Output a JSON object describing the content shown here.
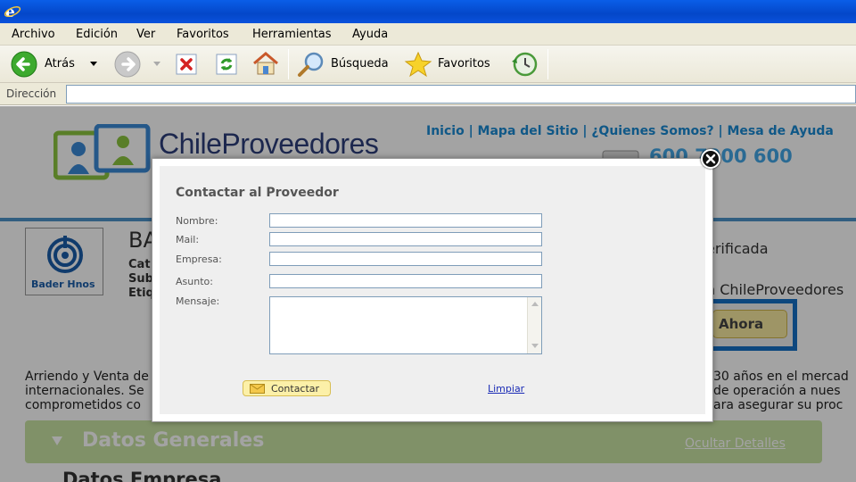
{
  "menu": {
    "items": [
      {
        "label": "Archivo"
      },
      {
        "label": "Edición"
      },
      {
        "label": "Ver"
      },
      {
        "label": "Favoritos"
      },
      {
        "label": "Herramientas"
      },
      {
        "label": "Ayuda"
      }
    ]
  },
  "toolbar": {
    "back_label": "Atrás",
    "search_label": "Búsqueda",
    "favorites_label": "Favoritos"
  },
  "address": {
    "label": "Dirección",
    "value": ""
  },
  "page": {
    "logo_text": "ChileProveedores",
    "top_links": "Inicio | Mapa del Sitio | ¿Quienes Somos? | Mesa de Ayuda",
    "phone": "600 7000 600",
    "company_logo_text": "Bader Hnos",
    "company_name": "BA",
    "category_lines": [
      "Cat",
      "Sub",
      "Etiq"
    ],
    "verified_text": "erificada",
    "member_text": "n ChileProveedores",
    "ahora_label": "Ahora",
    "description_left": [
      "Arriendo y Venta de",
      "internacionales. Se",
      "comprometidos co"
    ],
    "description_right": [
      "30 años en el mercad",
      "de operación a nues",
      "ara asegurar su proc"
    ],
    "datos_generales_title": "Datos Generales",
    "ocultar_label": "Ocultar Detalles",
    "datos_empresa_title": "Datos Empresa"
  },
  "modal": {
    "title": "Contactar al Proveedor",
    "fields": {
      "nombre": {
        "label": "Nombre:",
        "value": ""
      },
      "mail": {
        "label": "Mail:",
        "value": ""
      },
      "empresa": {
        "label": "Empresa:",
        "value": ""
      },
      "asunto": {
        "label": "Asunto:",
        "value": ""
      },
      "mensaje": {
        "label": "Mensaje:",
        "value": ""
      }
    },
    "contact_button_label": "Contactar",
    "clear_label": "Limpiar"
  },
  "colors": {
    "accent_blue": "#1a8ad4",
    "link_color": "#1a2bb5",
    "button_yellow": "#fcf0a8",
    "section_green": "#c9e3a3"
  }
}
